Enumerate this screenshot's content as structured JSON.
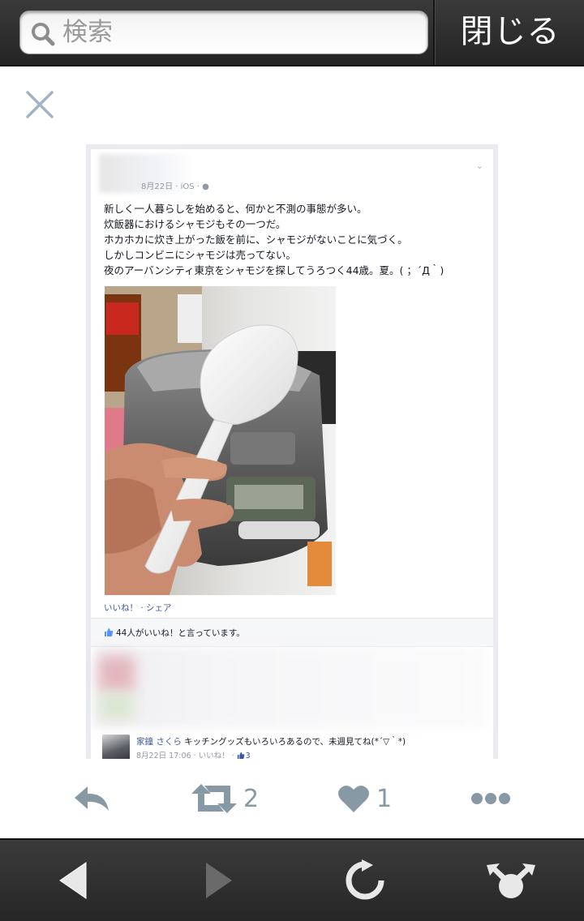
{
  "search": {
    "placeholder": "検索",
    "icon": "search-icon"
  },
  "header": {
    "close_label": "閉じる"
  },
  "post": {
    "date_meta": "8月22日 · iOS · ",
    "text": "新しく一人暮らしを始めると、何かと不測の事態が多い。\n炊飯器におけるシャモジもその一つだ。\nホカホカに炊き上がった飯を前に、シャモジがないことに気づく。\nしかしコンビニにシャモジは売ってない。\n夜のアーバンシティ東京をシャモジを探してうろつく44歳。夏。( ；´Д｀)",
    "actions": "いいね！ · シェア",
    "likes": "44人がいいね！と言っています。",
    "comment": {
      "author": "家鐘 さくら",
      "body": " キッチングッズもいろいろあるので、未週見てね(*´▽｀*)",
      "meta": "8月22日 17:06 · いいね！ · ",
      "like_count": "3"
    }
  },
  "tweet_actions": {
    "retweet_count": "2",
    "favorite_count": "1"
  },
  "colors": {
    "action_gray": "#8899a6",
    "fb_blue": "#3b5998",
    "bar_dark": "#2a2a2a"
  }
}
